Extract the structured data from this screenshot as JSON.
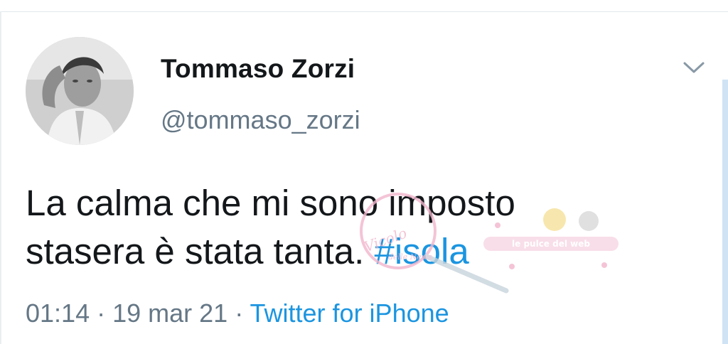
{
  "tweet": {
    "display_name": "Tommaso Zorzi",
    "handle": "@tommaso_zorzi",
    "text_line1": "La calma che mi sono imposto",
    "text_line2_plain": "stasera è stata tanta. ",
    "hashtag": "#isola",
    "time": "01:14",
    "separator": " · ",
    "date": "19 mar 21",
    "source": "Twitter for iPhone"
  },
  "watermark": {
    "script_text": "Vicolo delle News",
    "banner_text": "le pulce del web"
  },
  "icons": {
    "more_menu": "chevron-down-icon"
  },
  "colors": {
    "text": "#14171a",
    "secondary": "#657786",
    "link": "#1b95e0",
    "watermark_pink": "#f2b6cd"
  }
}
